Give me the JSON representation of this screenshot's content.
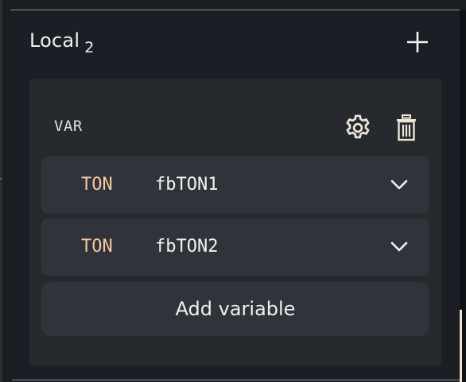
{
  "section": {
    "title": "Local",
    "count": "2"
  },
  "block": {
    "label": "VAR"
  },
  "variables": [
    {
      "type": "TON",
      "name": "fbTON1"
    },
    {
      "type": "TON",
      "name": "fbTON2"
    }
  ],
  "actions": {
    "add_variable": "Add variable"
  },
  "icons": {
    "add_section": "plus-icon",
    "settings": "gear-icon",
    "delete": "trash-icon",
    "expand": "chevron-down-icon"
  },
  "colors": {
    "background": "#1a1e23",
    "card": "#26292e",
    "row": "#30343a",
    "type_text": "#f3c9a1",
    "accent": "#f1e4c8"
  }
}
